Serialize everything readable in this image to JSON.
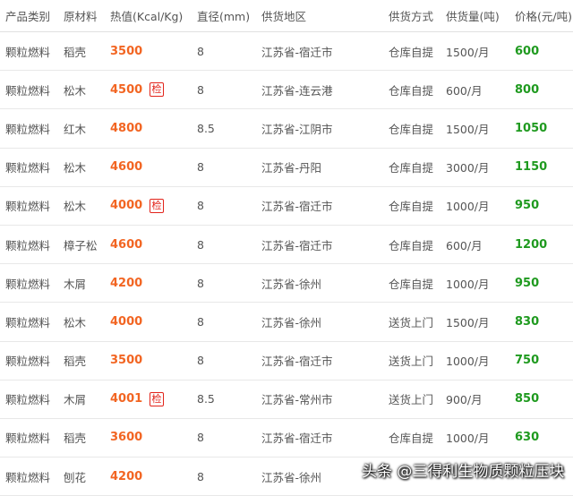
{
  "columns": [
    "产品类别",
    "原材料",
    "热值(Kcal/Kg)",
    "直径(mm)",
    "供货地区",
    "供货方式",
    "供货量(吨)",
    "价格(元/吨)"
  ],
  "badge_text": "检",
  "rows": [
    {
      "category": "颗粒燃料",
      "material": "稻壳",
      "heat": "3500",
      "inspected": false,
      "diameter": "8",
      "region": "江苏省-宿迁市",
      "method": "仓库自提",
      "supply": "1500/月",
      "price": "600"
    },
    {
      "category": "颗粒燃料",
      "material": "松木",
      "heat": "4500",
      "inspected": true,
      "diameter": "8",
      "region": "江苏省-连云港",
      "method": "仓库自提",
      "supply": "600/月",
      "price": "800"
    },
    {
      "category": "颗粒燃料",
      "material": "红木",
      "heat": "4800",
      "inspected": false,
      "diameter": "8.5",
      "region": "江苏省-江阴市",
      "method": "仓库自提",
      "supply": "1500/月",
      "price": "1050"
    },
    {
      "category": "颗粒燃料",
      "material": "松木",
      "heat": "4600",
      "inspected": false,
      "diameter": "8",
      "region": "江苏省-丹阳",
      "method": "仓库自提",
      "supply": "3000/月",
      "price": "1150"
    },
    {
      "category": "颗粒燃料",
      "material": "松木",
      "heat": "4000",
      "inspected": true,
      "diameter": "8",
      "region": "江苏省-宿迁市",
      "method": "仓库自提",
      "supply": "1000/月",
      "price": "950"
    },
    {
      "category": "颗粒燃料",
      "material": "樟子松",
      "heat": "4600",
      "inspected": false,
      "diameter": "8",
      "region": "江苏省-宿迁市",
      "method": "仓库自提",
      "supply": "600/月",
      "price": "1200"
    },
    {
      "category": "颗粒燃料",
      "material": "木屑",
      "heat": "4200",
      "inspected": false,
      "diameter": "8",
      "region": "江苏省-徐州",
      "method": "仓库自提",
      "supply": "1000/月",
      "price": "950"
    },
    {
      "category": "颗粒燃料",
      "material": "松木",
      "heat": "4000",
      "inspected": false,
      "diameter": "8",
      "region": "江苏省-徐州",
      "method": "送货上门",
      "supply": "1500/月",
      "price": "830"
    },
    {
      "category": "颗粒燃料",
      "material": "稻壳",
      "heat": "3500",
      "inspected": false,
      "diameter": "8",
      "region": "江苏省-宿迁市",
      "method": "送货上门",
      "supply": "1000/月",
      "price": "750"
    },
    {
      "category": "颗粒燃料",
      "material": "木屑",
      "heat": "4001",
      "inspected": true,
      "diameter": "8.5",
      "region": "江苏省-常州市",
      "method": "送货上门",
      "supply": "900/月",
      "price": "850"
    },
    {
      "category": "颗粒燃料",
      "material": "稻壳",
      "heat": "3600",
      "inspected": false,
      "diameter": "8",
      "region": "江苏省-宿迁市",
      "method": "仓库自提",
      "supply": "1000/月",
      "price": "630"
    },
    {
      "category": "颗粒燃料",
      "material": "刨花",
      "heat": "4200",
      "inspected": false,
      "diameter": "8",
      "region": "江苏省-徐州",
      "method": "",
      "supply": "",
      "price": ""
    }
  ],
  "watermark": "头条 @三得利生物质颗粒压块",
  "colors": {
    "heat": "#f26522",
    "price": "#1f9a1f",
    "badge": "#e2231a",
    "border": "#e8e8e8"
  }
}
